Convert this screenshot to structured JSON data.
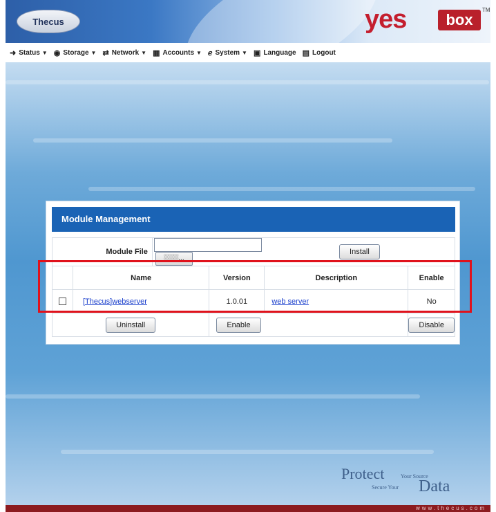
{
  "header": {
    "brand_left": "Thecus",
    "brand_right_yes": "yes",
    "brand_right_box": "box",
    "trademark": "TM"
  },
  "menu": [
    {
      "label": "Status",
      "icon": "arrow-icon",
      "has_dropdown": true
    },
    {
      "label": "Storage",
      "icon": "disk-icon",
      "has_dropdown": true
    },
    {
      "label": "Network",
      "icon": "network-icon",
      "has_dropdown": true
    },
    {
      "label": "Accounts",
      "icon": "accounts-icon",
      "has_dropdown": true
    },
    {
      "label": "System",
      "icon": "wrench-icon",
      "has_dropdown": true
    },
    {
      "label": "Language",
      "icon": "language-icon",
      "has_dropdown": false
    },
    {
      "label": "Logout",
      "icon": "logout-icon",
      "has_dropdown": false
    }
  ],
  "module_panel": {
    "title": "Module Management",
    "file_label": "Module File",
    "file_value": "",
    "browse_label": "░░░...",
    "install_label": "Install",
    "columns": [
      "Name",
      "Version",
      "Description",
      "Enable"
    ],
    "rows": [
      {
        "checked": false,
        "name": "[Thecus]webserver",
        "version": "1.0.01",
        "description": "web server",
        "enable": "No"
      }
    ],
    "uninstall_label": "Uninstall",
    "enable_label": "Enable",
    "disable_label": "Disable"
  },
  "footer": {
    "protect": "Protect",
    "your_source": "Your Source",
    "secure_your": "Secure Your",
    "data": "Data",
    "url": "www.thecus.com"
  },
  "colors": {
    "title_bar": "#1a63b5",
    "highlight_box": "#e0121c",
    "bottom_bar": "#8c1b1f"
  }
}
